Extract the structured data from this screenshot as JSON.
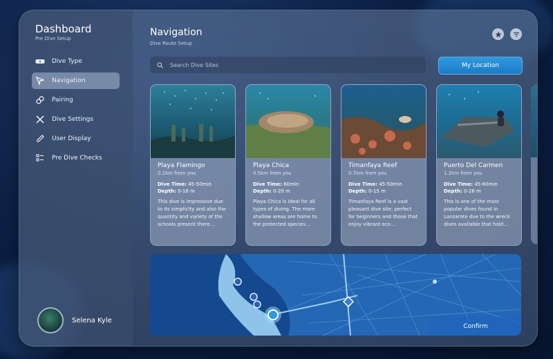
{
  "sidebar": {
    "title": "Dashboard",
    "subtitle": "Pre Dive Setup",
    "items": [
      {
        "label": "Dive Type",
        "icon": "goggles-icon"
      },
      {
        "label": "Navigation",
        "icon": "cursor-arrow-icon",
        "active": true
      },
      {
        "label": "Pairing",
        "icon": "link-icon"
      },
      {
        "label": "Dive Settings",
        "icon": "tools-icon"
      },
      {
        "label": "User Display",
        "icon": "pen-icon"
      },
      {
        "label": "Pre Dive Checks",
        "icon": "checklist-icon"
      }
    ],
    "user": {
      "name": "Selena Kyle"
    }
  },
  "header": {
    "title": "Navigation",
    "subtitle": "Dive Route Setup",
    "icons": [
      "star-icon",
      "filter-icon"
    ]
  },
  "search": {
    "placeholder": "Search Dive Sites"
  },
  "location_button": "My Location",
  "cards": [
    {
      "name": "Playa Flamingo",
      "distance": "0.2km from you",
      "dive_time_label": "Dive Time:",
      "dive_time": "45-50min",
      "depth_label": "Depth:",
      "depth": "0-18 m",
      "description": "This dive is impressive due to its simplicity and also the quantity and variety of the schools present there..."
    },
    {
      "name": "Playa Chica",
      "distance": "0.5km from you",
      "dive_time_label": "Dive Time:",
      "dive_time": "60min",
      "depth_label": "Depth:",
      "depth": "0-20 m",
      "description": "Playa Chica is ideal for all types of diving. The more shallow areas are home to the protected species..."
    },
    {
      "name": "Timanfaya Reef",
      "distance": "0.7km from you",
      "dive_time_label": "Dive Time:",
      "dive_time": "45-50min",
      "depth_label": "Depth:",
      "depth": "0-15 m",
      "description": "Timanfaya Reef is a vast pleasant dive site, perfect for beginners and those that enjoy vibrant eco..."
    },
    {
      "name": "Puerto Del Carmen",
      "distance": "1.2km from you",
      "dive_time_label": "Dive Time:",
      "dive_time": "45-60min",
      "depth_label": "Depth:",
      "depth": "0-26 m",
      "description": "This is one of the most popular dives found in Lanzarote due to the wreck dives available that hold..."
    }
  ],
  "map": {
    "confirm_label": "Confirm"
  },
  "colors": {
    "accent": "#2a8fd9",
    "background": "#0d2147"
  }
}
